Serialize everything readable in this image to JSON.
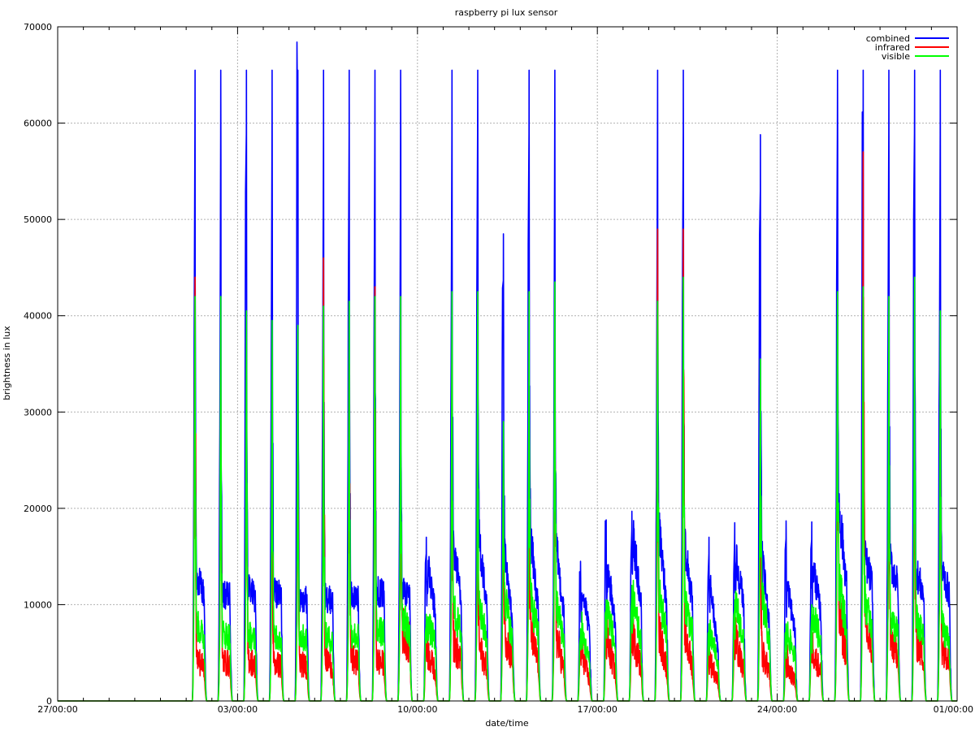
{
  "chart_data": {
    "type": "line",
    "title": "raspberry pi lux sensor",
    "xlabel": "date/time",
    "ylabel": "brightness in lux",
    "ylim": [
      0,
      70000
    ],
    "xlim_days": [
      0,
      35
    ],
    "y_ticks": [
      0,
      10000,
      20000,
      30000,
      40000,
      50000,
      60000,
      70000
    ],
    "x_ticks": [
      {
        "day": 0,
        "label": "27/00:00"
      },
      {
        "day": 7,
        "label": "03/00:00"
      },
      {
        "day": 14,
        "label": "10/00:00"
      },
      {
        "day": 21,
        "label": "17/00:00"
      },
      {
        "day": 28,
        "label": "24/00:00"
      },
      {
        "day": 35,
        "label": "01/00:00"
      }
    ],
    "x_minor_ticks_days": [
      1,
      2,
      3,
      4,
      5,
      6,
      8,
      9,
      10,
      11,
      12,
      13,
      15,
      16,
      17,
      18,
      19,
      20,
      22,
      23,
      24,
      25,
      26,
      27,
      29,
      30,
      31,
      32,
      33,
      34
    ],
    "grid": true,
    "legend": "top-right",
    "series": [
      {
        "name": "combined",
        "color": "#0000ff"
      },
      {
        "name": "infrared",
        "color": "#ff0000"
      },
      {
        "name": "visible",
        "color": "#00ff00"
      }
    ],
    "days": [
      {
        "day": 5,
        "combined": [
          35000,
          65500,
          13000,
          11000
        ],
        "infrared": [
          18000,
          44000,
          4500,
          3500
        ],
        "visible": [
          16000,
          42000,
          8000,
          6500
        ]
      },
      {
        "day": 6,
        "combined": [
          30000,
          65500,
          11000,
          10800
        ],
        "infrared": [
          10000,
          33000,
          4200,
          3800
        ],
        "visible": [
          9000,
          42000,
          7000,
          6700
        ]
      },
      {
        "day": 7,
        "combined": [
          49000,
          65500,
          12000,
          10500
        ],
        "infrared": [
          9000,
          28000,
          4500,
          3600
        ],
        "visible": [
          9000,
          40500,
          7000,
          6200
        ]
      },
      {
        "day": 8,
        "combined": [
          36000,
          65500,
          11500,
          10800
        ],
        "infrared": [
          9000,
          20000,
          4000,
          3600
        ],
        "visible": [
          9000,
          39500,
          7000,
          6400
        ]
      },
      {
        "day": 9,
        "combined": [
          60000,
          65500,
          10800,
          10500
        ],
        "infrared": [
          9000,
          30000,
          4000,
          3500
        ],
        "visible": [
          9000,
          39000,
          6800,
          6300
        ]
      },
      {
        "day": 10,
        "combined": [
          35000,
          65500,
          10800,
          10300
        ],
        "infrared": [
          10000,
          46000,
          4500,
          3500
        ],
        "visible": [
          9000,
          41000,
          6800,
          6100
        ]
      },
      {
        "day": 11,
        "combined": [
          40000,
          65500,
          11000,
          10500
        ],
        "infrared": [
          10000,
          35000,
          4500,
          3800
        ],
        "visible": [
          9500,
          41500,
          7000,
          6600
        ]
      },
      {
        "day": 12,
        "combined": [
          36000,
          65500,
          11500,
          11000
        ],
        "infrared": [
          10000,
          43000,
          4200,
          3800
        ],
        "visible": [
          9000,
          42000,
          7500,
          7000
        ]
      },
      {
        "day": 13,
        "combined": [
          30000,
          65500,
          11500,
          11000
        ],
        "infrared": [
          9000,
          20000,
          7500,
          6000
        ],
        "visible": [
          9000,
          42000,
          9000,
          7000
        ]
      },
      {
        "day": 14,
        "combined": [
          16000,
          17000,
          14000,
          9000
        ],
        "infrared": [
          5500,
          6000,
          5000,
          3000
        ],
        "visible": [
          8000,
          9000,
          8000,
          6000
        ]
      },
      {
        "day": 15,
        "combined": [
          40000,
          65500,
          16000,
          11000
        ],
        "infrared": [
          10000,
          35000,
          6000,
          4000
        ],
        "visible": [
          10000,
          42500,
          9500,
          7000
        ]
      },
      {
        "day": 16,
        "combined": [
          39000,
          65500,
          17000,
          9500
        ],
        "infrared": [
          10000,
          20000,
          5500,
          3500
        ],
        "visible": [
          10000,
          42500,
          9500,
          6500
        ]
      },
      {
        "day": 17,
        "combined": [
          44000,
          48500,
          15000,
          8000
        ],
        "infrared": [
          10000,
          20000,
          7500,
          4000
        ],
        "visible": [
          12000,
          29000,
          11000,
          6000
        ]
      },
      {
        "day": 18,
        "combined": [
          45000,
          65500,
          17000,
          9500
        ],
        "infrared": [
          11000,
          24000,
          7000,
          4000
        ],
        "visible": [
          12000,
          42500,
          10500,
          7000
        ]
      },
      {
        "day": 19,
        "combined": [
          26000,
          65500,
          16000,
          9000
        ],
        "infrared": [
          7000,
          30000,
          7000,
          3000
        ],
        "visible": [
          10000,
          43500,
          10000,
          6500
        ]
      },
      {
        "day": 20,
        "combined": [
          12000,
          14500,
          12000,
          7000
        ],
        "infrared": [
          4000,
          5500,
          5000,
          2000
        ],
        "visible": [
          6000,
          7500,
          7000,
          4000
        ]
      },
      {
        "day": 21,
        "combined": [
          17000,
          18800,
          14000,
          8000
        ],
        "infrared": [
          5500,
          7500,
          6000,
          3000
        ],
        "visible": [
          8500,
          10500,
          9500,
          5500
        ]
      },
      {
        "day": 22,
        "combined": [
          17000,
          19700,
          17000,
          10000
        ],
        "infrared": [
          5500,
          8000,
          6500,
          3500
        ],
        "visible": [
          9000,
          12000,
          10000,
          6000
        ]
      },
      {
        "day": 23,
        "combined": [
          36000,
          65500,
          17700,
          10000
        ],
        "infrared": [
          10000,
          49000,
          7000,
          3500
        ],
        "visible": [
          11000,
          41500,
          11000,
          7000
        ]
      },
      {
        "day": 24,
        "combined": [
          40000,
          65500,
          16500,
          10000
        ],
        "infrared": [
          11000,
          49000,
          7000,
          3500
        ],
        "visible": [
          12000,
          44000,
          10500,
          7000
        ]
      },
      {
        "day": 25,
        "combined": [
          15000,
          17000,
          12000,
          5000
        ],
        "infrared": [
          4500,
          6000,
          4000,
          2000
        ],
        "visible": [
          7000,
          8000,
          7000,
          4000
        ]
      },
      {
        "day": 26,
        "combined": [
          15000,
          18500,
          15000,
          10000
        ],
        "infrared": [
          5000,
          7000,
          6000,
          3000
        ],
        "visible": [
          8000,
          10500,
          10000,
          6000
        ]
      },
      {
        "day": 27,
        "combined": [
          53000,
          58800,
          15000,
          8000
        ],
        "infrared": [
          12000,
          23000,
          5000,
          3000
        ],
        "visible": [
          13000,
          35500,
          11000,
          6000
        ]
      },
      {
        "day": 28,
        "combined": [
          16000,
          18700,
          12000,
          7000
        ],
        "infrared": [
          4000,
          5000,
          3500,
          2000
        ],
        "visible": [
          6500,
          8000,
          7000,
          4500
        ]
      },
      {
        "day": 29,
        "combined": [
          17000,
          18600,
          14000,
          9000
        ],
        "infrared": [
          5500,
          6000,
          5000,
          3000
        ],
        "visible": [
          8000,
          10000,
          9000,
          6000
        ]
      },
      {
        "day": 30,
        "combined": [
          38000,
          65500,
          20500,
          12000
        ],
        "infrared": [
          10000,
          30000,
          9000,
          5000
        ],
        "visible": [
          12000,
          42500,
          13000,
          7000
        ]
      },
      {
        "day": 31,
        "combined": [
          63000,
          65500,
          15000,
          12000
        ],
        "infrared": [
          15000,
          57000,
          8000,
          5000
        ],
        "visible": [
          14000,
          43000,
          11000,
          7000
        ]
      },
      {
        "day": 32,
        "combined": [
          40000,
          65500,
          14500,
          12000
        ],
        "infrared": [
          10000,
          24000,
          6500,
          5000
        ],
        "visible": [
          12000,
          42000,
          8500,
          7000
        ]
      },
      {
        "day": 33,
        "combined": [
          57000,
          65500,
          13500,
          11000
        ],
        "infrared": [
          10000,
          28000,
          6500,
          4500
        ],
        "visible": [
          12000,
          44000,
          8500,
          6500
        ]
      },
      {
        "day": 34,
        "combined": [
          40000,
          65500,
          13700,
          11000
        ],
        "infrared": [
          10000,
          30000,
          5800,
          4500
        ],
        "visible": [
          11000,
          40500,
          8000,
          6000
        ]
      }
    ]
  }
}
